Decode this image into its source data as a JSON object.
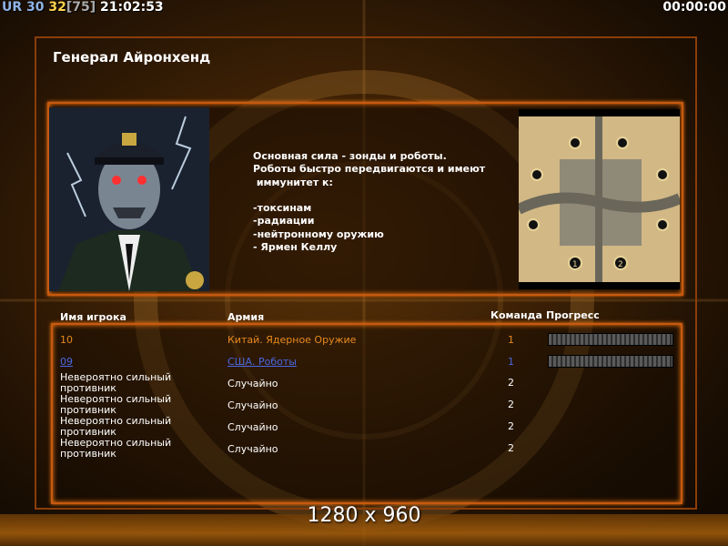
{
  "hud": {
    "ur": "UR",
    "v30": "30",
    "v32": "32",
    "v75": "[75]",
    "time": "21:02:53",
    "timer": "00:00:00"
  },
  "title": "Генерал Айронхенд",
  "description": "Основная сила - зонды и роботы.\nРоботы быстро передвигаются и имеют\n иммунитет к:\n\n-токсинам\n-радиации\n-нейтронному оружию\n- Ярмен Келлу",
  "headers": {
    "name": "Имя игрока",
    "army": "Армия",
    "team": "Команда",
    "progress": "Прогресс"
  },
  "players": [
    {
      "name": "10",
      "army": "Китай. Ядерное Оружие",
      "team": "1",
      "color": "#e98a1e",
      "progress": 1.0
    },
    {
      "name": "09",
      "army": "США. Роботы",
      "team": "1",
      "color": "#4a68e0",
      "progress": 1.0
    },
    {
      "name": "Невероятно сильный противник",
      "army": "Случайно",
      "team": "2",
      "color": "#ffffff"
    },
    {
      "name": "Невероятно сильный противник",
      "army": "Случайно",
      "team": "2",
      "color": "#ffffff"
    },
    {
      "name": "Невероятно сильный противник",
      "army": "Случайно",
      "team": "2",
      "color": "#ffffff"
    },
    {
      "name": "Невероятно сильный противник",
      "army": "Случайно",
      "team": "2",
      "color": "#ffffff"
    }
  ],
  "map": {
    "start_labels": [
      "1",
      "2"
    ]
  },
  "resolution": "1280 x 960",
  "colors": {
    "frame": "#c75a10",
    "background": "#3a1f05"
  }
}
